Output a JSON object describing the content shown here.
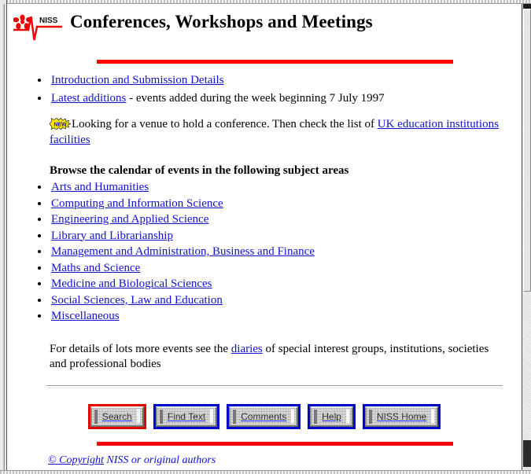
{
  "page": {
    "title": "Conferences, Workshops and Meetings",
    "logo_alt": "NISS",
    "logo_text": "NISS"
  },
  "colors": {
    "rule_red": "#fe0000",
    "link_blue": "#1111cc",
    "button_border_blue": "#0000cc",
    "button_border_active_red": "#e50000",
    "button_face_gray": "#c6c6c6",
    "logo_red": "#ee0000"
  },
  "top_links": [
    {
      "label": "Introduction and Submission Details",
      "trailing_text": ""
    },
    {
      "label": "Latest additions",
      "trailing_text": " - events added during the week beginning 7 July 1997"
    }
  ],
  "venue_note": {
    "badge": "new-starburst-icon",
    "badge_text": "NEW",
    "text_before": "Looking for a venue to hold a conference. Then check the list of ",
    "link": "UK education institutions facilities",
    "text_after": ""
  },
  "browse": {
    "heading": "Browse the calendar of events in the following subject areas",
    "subjects": [
      "Arts and Humanities",
      "Computing and Information Science",
      "Engineering and Applied Science",
      "Library and Librarianship",
      "Management and Administration, Business and Finance",
      "Maths and Science",
      "Medicine and Biological Sciences",
      "Social Sciences, Law and Education",
      "Miscellaneous"
    ]
  },
  "diaries_note": {
    "text_before": "For details of lots more events see the ",
    "link": "diaries",
    "text_after": " of special interest groups, institutions, societies and professional bodies"
  },
  "buttons": [
    {
      "label": "Search",
      "state": "active"
    },
    {
      "label": "Find Text",
      "state": "normal"
    },
    {
      "label": "Comments",
      "state": "normal"
    },
    {
      "label": "Help",
      "state": "normal"
    },
    {
      "label": "NISS Home",
      "state": "normal"
    }
  ],
  "footer": {
    "copyright_symbol": "© Copyright",
    "copyright_rest": " NISS or original authors"
  }
}
